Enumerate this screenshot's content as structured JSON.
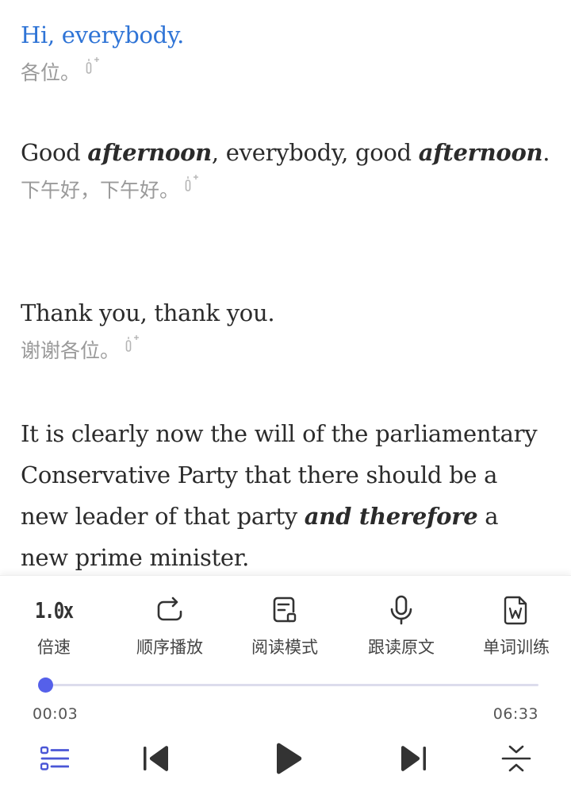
{
  "reader": {
    "sentences": [
      {
        "en": "Hi, everybody.",
        "zh": "各位。"
      },
      {
        "en_parts": [
          "Good ",
          "afternoon",
          ", everybody, good ",
          "afternoon",
          "."
        ],
        "zh": "下午好，下午好。"
      },
      {
        "en": "Thank you, thank you.",
        "zh": "谢谢各位。"
      },
      {
        "en_parts": [
          "It is clearly now the will of the parliamentary Conservative Party that there should be a new leader of that party ",
          "and therefore",
          " a new prime minister."
        ]
      }
    ]
  },
  "toolbar": {
    "speed_value": "1.0x",
    "speed_label": "倍速",
    "order_label": "顺序播放",
    "read_mode_label": "阅读模式",
    "follow_read_label": "跟读原文",
    "word_training_label": "单词训练"
  },
  "player": {
    "current_time": "00:03",
    "total_time": "06:33",
    "progress_fraction": 0.0077
  },
  "colors": {
    "active_text": "#2f74d6",
    "accent": "#5560ea"
  },
  "icons": {
    "note": "note-plus-icon",
    "repeat": "repeat-icon",
    "read_mode": "document-icon",
    "mic": "microphone-icon",
    "word": "word-document-icon",
    "playlist": "playlist-icon",
    "prev": "skip-previous-icon",
    "play": "play-icon",
    "next": "skip-next-icon",
    "collapse": "collapse-icon"
  }
}
